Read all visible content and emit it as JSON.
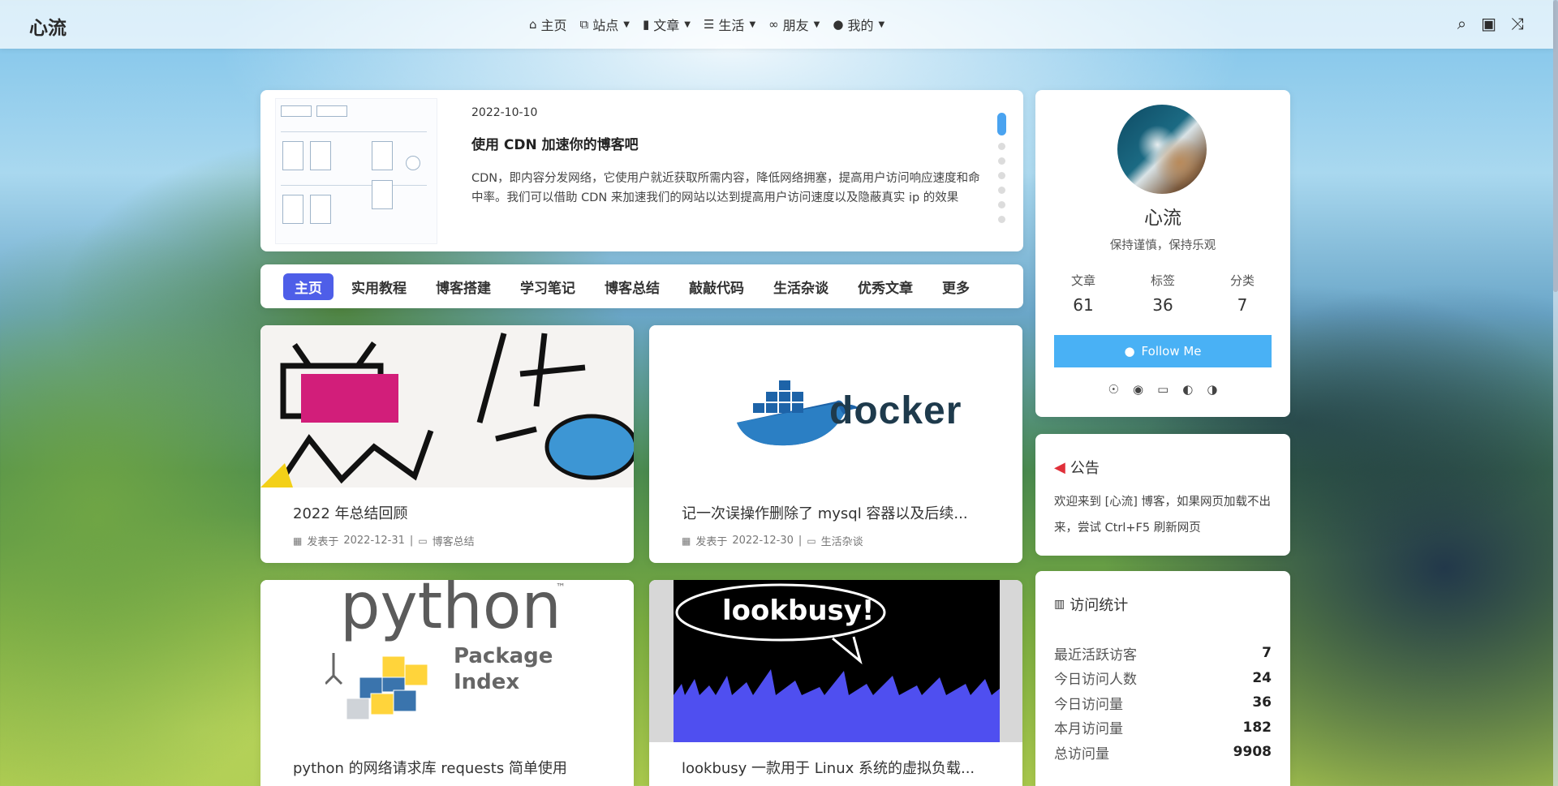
{
  "header": {
    "logo": "心流",
    "nav": [
      {
        "label": "主页",
        "icon": "home-icon",
        "has_dropdown": false
      },
      {
        "label": "站点",
        "icon": "sitemap-icon",
        "has_dropdown": true
      },
      {
        "label": "文章",
        "icon": "bookmark-icon",
        "has_dropdown": true
      },
      {
        "label": "生活",
        "icon": "list-icon",
        "has_dropdown": true
      },
      {
        "label": "朋友",
        "icon": "link-icon",
        "has_dropdown": true
      },
      {
        "label": "我的",
        "icon": "user-icon",
        "has_dropdown": true
      }
    ],
    "right_icons": [
      "search-icon",
      "train-icon",
      "shuffle-icon"
    ]
  },
  "featured": {
    "date": "2022-10-10",
    "title": "使用 CDN 加速你的博客吧",
    "description": "CDN，即内容分发网络，它使用户就近获取所需内容，降低网络拥塞，提高用户访问响应速度和命中率。我们可以借助 CDN 来加速我们的网站以达到提高用户访问速度以及隐蔽真实 ip 的效果",
    "slide_count": 7,
    "active_slide": 1
  },
  "tabs": [
    {
      "label": "主页",
      "active": true
    },
    {
      "label": "实用教程",
      "active": false
    },
    {
      "label": "博客搭建",
      "active": false
    },
    {
      "label": "学习笔记",
      "active": false
    },
    {
      "label": "博客总结",
      "active": false
    },
    {
      "label": "敲敲代码",
      "active": false
    },
    {
      "label": "生活杂谈",
      "active": false
    },
    {
      "label": "优秀文章",
      "active": false
    },
    {
      "label": "更多",
      "active": false
    }
  ],
  "posts": [
    {
      "title": "2022 年总结回顾",
      "meta_prefix": "发表于",
      "date": "2022-12-31",
      "category": "博客总结",
      "image_text": ""
    },
    {
      "title": "记一次误操作删除了 mysql 容器以及后续...",
      "meta_prefix": "发表于",
      "date": "2022-12-30",
      "category": "生活杂谈",
      "image_text": "docker"
    },
    {
      "title": "python 的网络请求库 requests 简单使用",
      "image_text": "python",
      "image_sub": "Package Index",
      "image_tm": "™"
    },
    {
      "title": "lookbusy 一款用于 Linux 系统的虚拟负载...",
      "image_text": "lookbusy!"
    }
  ],
  "profile": {
    "name": "心流",
    "description": "保持谨慎，保持乐观",
    "stats": [
      {
        "label": "文章",
        "value": "61"
      },
      {
        "label": "标签",
        "value": "36"
      },
      {
        "label": "分类",
        "value": "7"
      }
    ],
    "follow_label": "Follow Me",
    "social_icons": [
      "rss-icon",
      "github-icon",
      "bilibili-icon",
      "gitee-icon",
      "csdn-icon"
    ]
  },
  "notice": {
    "title": "公告",
    "body": "欢迎来到 [心流] 博客，如果网页加载不出来，尝试 Ctrl+F5 刷新网页"
  },
  "visits": {
    "title": "访问统计",
    "rows": [
      {
        "label": "最近活跃访客",
        "value": "7"
      },
      {
        "label": "今日访问人数",
        "value": "24"
      },
      {
        "label": "今日访问量",
        "value": "36"
      },
      {
        "label": "本月访问量",
        "value": "182"
      },
      {
        "label": "总访问量",
        "value": "9908"
      }
    ]
  },
  "colors": {
    "accent": "#49b1f5",
    "active_tab": "#4e5ee8",
    "notice_icon": "#e0303a"
  }
}
